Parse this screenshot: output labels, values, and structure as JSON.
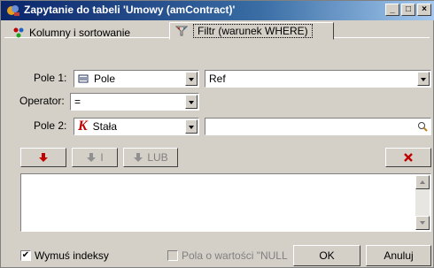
{
  "window": {
    "title": "Zapytanie do tabeli 'Umowy (amContract)'"
  },
  "titlebar_buttons": {
    "minimize": "_",
    "maximize": "□",
    "close": "×"
  },
  "tabs": [
    {
      "label": "Kolumny i sortowanie",
      "active": false
    },
    {
      "label": "Filtr (warunek WHERE)",
      "active": true
    }
  ],
  "form": {
    "pole1_label": "Pole 1:",
    "pole1_type": "Pole",
    "pole1_value": "Ref",
    "operator_label": "Operator:",
    "operator_value": "=",
    "pole2_label": "Pole 2:",
    "pole2_type": "Stała",
    "pole2_value": ""
  },
  "buttons": {
    "and_label": "I",
    "or_label": "LUB"
  },
  "where_text": "",
  "footer": {
    "force_index_label": "Wymuś indeksy",
    "force_index_checked": true,
    "null_values_label": "Pola o wartości \"NULL",
    "null_values_checked": false,
    "ok_label": "OK",
    "cancel_label": "Anuluj"
  },
  "colors": {
    "title_start": "#0a246a",
    "title_end": "#a6caf0",
    "arrow_red": "#c00000",
    "face": "#d4d0c8"
  }
}
